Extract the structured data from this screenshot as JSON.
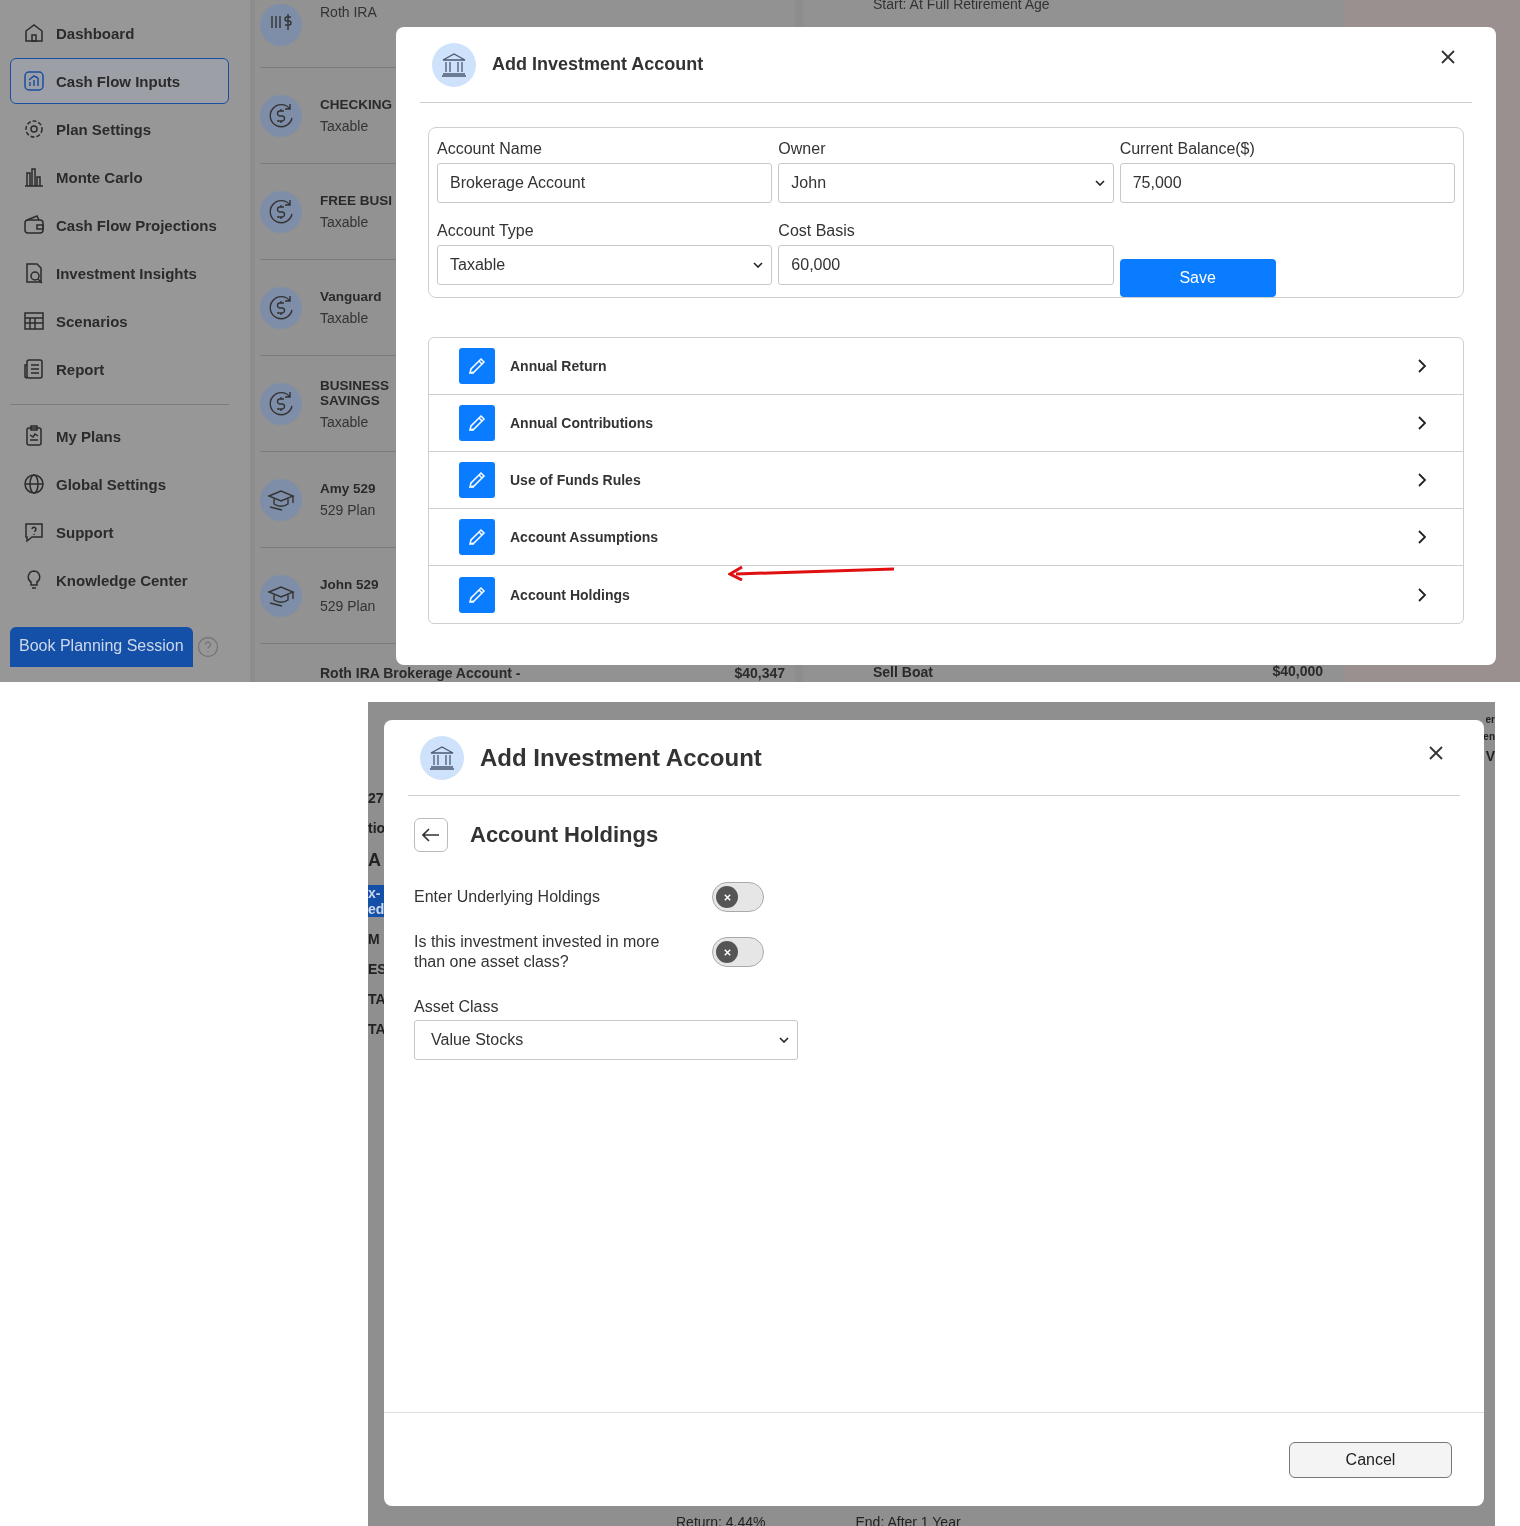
{
  "top_screen": {
    "sidebar": {
      "main_items": [
        {
          "label": "Dashboard",
          "selected": false
        },
        {
          "label": "Cash Flow Inputs",
          "selected": true
        },
        {
          "label": "Plan Settings",
          "selected": false
        },
        {
          "label": "Monte Carlo",
          "selected": false
        },
        {
          "label": "Cash Flow Projections",
          "selected": false
        },
        {
          "label": "Investment Insights",
          "selected": false
        },
        {
          "label": "Scenarios",
          "selected": false
        },
        {
          "label": "Report",
          "selected": false
        }
      ],
      "secondary_items": [
        {
          "label": "My Plans",
          "selected": false
        },
        {
          "label": "Global Settings",
          "selected": false
        },
        {
          "label": "Support",
          "selected": false
        },
        {
          "label": "Knowledge Center",
          "selected": false
        }
      ],
      "book_button": "Book Planning Session"
    },
    "accounts": [
      {
        "type": "Roth IRA"
      },
      {
        "name": "CHECKING",
        "type": "Taxable"
      },
      {
        "name": "FREE BUSI",
        "type": "Taxable"
      },
      {
        "name": "Vanguard",
        "type": "Taxable"
      },
      {
        "name": "BUSINESS\nSAVINGS",
        "type": "Taxable"
      },
      {
        "name": "Amy 529",
        "type": "529 Plan"
      },
      {
        "name": "John 529",
        "type": "529 Plan"
      }
    ],
    "last_account": {
      "name": "Roth IRA Brokerage Account -",
      "amount": "$40,347"
    },
    "goals": {
      "first_detail": "Start: At Full Retirement Age",
      "last_name": "Sell Boat",
      "last_amount": "$40,000"
    },
    "modal": {
      "title": "Add Investment Account",
      "fields": [
        {
          "label": "Account Name",
          "value": "Brokerage Account",
          "kind": "input"
        },
        {
          "label": "Owner",
          "value": "John",
          "kind": "select"
        },
        {
          "label": "Current Balance($)",
          "value": "75,000",
          "kind": "input"
        },
        {
          "label": "Account Type",
          "value": "Taxable",
          "kind": "select"
        },
        {
          "label": "Cost Basis",
          "value": "60,000",
          "kind": "input"
        }
      ],
      "save_button": "Save",
      "sections": [
        "Annual Return",
        "Annual Contributions",
        "Use of Funds Rules",
        "Account Assumptions",
        "Account Holdings"
      ]
    }
  },
  "bottom_screen": {
    "left_fragments": [
      "27",
      "tio",
      "A",
      "x-\ned",
      "M",
      "ES",
      "TA",
      "TA"
    ],
    "right_fragments": [
      "er",
      "en",
      "V"
    ],
    "bottom_fragments": [
      "Return: 4.44%",
      "End: After 1 Year"
    ],
    "modal": {
      "title": "Add Investment Account",
      "subtitle": "Account Holdings",
      "toggles": [
        {
          "label": "Enter Underlying Holdings",
          "on": false
        },
        {
          "label": "Is this investment invested in more than one asset class?",
          "on": false
        }
      ],
      "asset_class": {
        "label": "Asset Class",
        "value": "Value Stocks"
      },
      "cancel_button": "Cancel"
    }
  }
}
